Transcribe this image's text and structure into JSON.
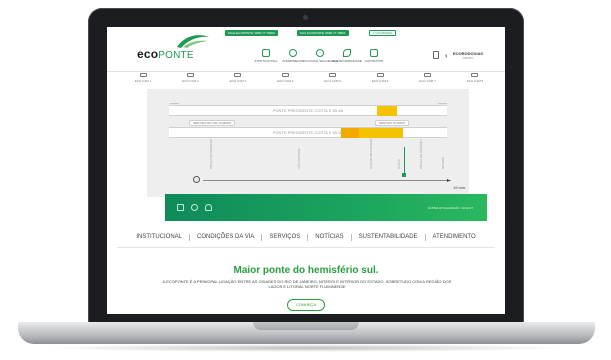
{
  "header": {
    "phone_numbers": [
      "FALE ECOPONTE: 0800 77 79600",
      "SAC ECOPONTE: 0800 77 79601",
      "2 OUVIDORIA"
    ],
    "logo": {
      "eco": "eco",
      "ponte": "PONTE"
    },
    "nav": [
      {
        "label": "INSTITUCIONAL",
        "icon": "building-icon"
      },
      {
        "label": "ATENDIMENTO",
        "icon": "headset-icon"
      },
      {
        "label": "CICLOVIA E SEGURANÇA",
        "icon": "bike-icon"
      },
      {
        "label": "SUSTENTABILIDADE",
        "icon": "leaf-icon"
      },
      {
        "label": "CONTRATOS",
        "icon": "document-icon"
      }
    ],
    "mini_logo": {
      "name": "ECORODOVIAS",
      "sub": "GRUPO"
    }
  },
  "cameras": [
    "ECO CAM 1",
    "ECO CAM 2",
    "ECO CAM 3",
    "ECO CAM 4",
    "ECO CAM 5",
    "ECO CAM 6",
    "ECO CAM 7",
    "ECO CAM 8"
  ],
  "map": {
    "lane_top": "PONTE PRESIDENTE COSTA E SILVA",
    "lane_bottom": "PONTE PRESIDENTE COSTA E SILVA",
    "tag_left": "SENTIDO RIO DE JANEIRO",
    "tag_right": "SENTIDO NITERÓI",
    "road_labels": [
      "PRAÇA DO PEDÁGIO",
      "VÃO CENTRAL",
      "ILHA DO MOCANGUÊ",
      "PLACA",
      "PRAÇA DE PEDÁGIO",
      "NITERÓI"
    ],
    "time": "19 min."
  },
  "banner": {
    "note": "ÚLTIMA ATUALIZAÇÃO: 13:42:17"
  },
  "menu": [
    "INSTITUCIONAL",
    "CONDIÇÕES DA VIA",
    "SERVIÇOS",
    "NOTÍCIAS",
    "SUSTENTABILIDADE",
    "ATENDIMENTO"
  ],
  "hero": {
    "title": "Maior ponte do hemisfério sul.",
    "text": "A ECOPONTE É A PRINCIPAL LIGAÇÃO ENTRE AS CIDADES DO RIO DE JANEIRO, NITERÓI E INTERIOR DO ESTADO, SOBRETUDO COM A REGIÃO DOS LAGOS E LITORAL NORTE FLUMINENSE",
    "cta": "CONHEÇA"
  },
  "colors": {
    "brand_green": "#1f9a55",
    "traffic_yellow": "#f5c200",
    "frame": "#1c1d20"
  }
}
